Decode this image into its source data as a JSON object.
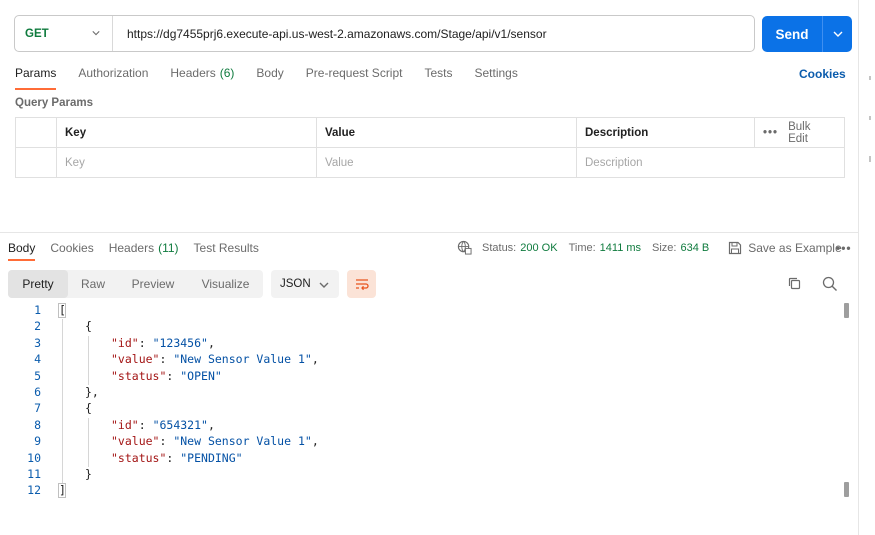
{
  "request": {
    "method": "GET",
    "url": "https://dg7455prj6.execute-api.us-west-2.amazonaws.com/Stage/api/v1/sensor",
    "send_label": "Send"
  },
  "request_tabs": [
    {
      "label": "Params",
      "count": "",
      "active": true
    },
    {
      "label": "Authorization",
      "count": "",
      "active": false
    },
    {
      "label": "Headers",
      "count": "(6)",
      "active": false
    },
    {
      "label": "Body",
      "count": "",
      "active": false
    },
    {
      "label": "Pre-request Script",
      "count": "",
      "active": false
    },
    {
      "label": "Tests",
      "count": "",
      "active": false
    },
    {
      "label": "Settings",
      "count": "",
      "active": false
    }
  ],
  "cookies_link": "Cookies",
  "query_params": {
    "title": "Query Params",
    "headers": {
      "key": "Key",
      "value": "Value",
      "description": "Description",
      "bulk_edit": "Bulk Edit"
    },
    "placeholders": {
      "key": "Key",
      "value": "Value",
      "description": "Description"
    }
  },
  "response_tabs": [
    {
      "label": "Body",
      "count": "",
      "active": true
    },
    {
      "label": "Cookies",
      "count": "",
      "active": false
    },
    {
      "label": "Headers",
      "count": "(11)",
      "active": false
    },
    {
      "label": "Test Results",
      "count": "",
      "active": false
    }
  ],
  "response_status": {
    "status_label": "Status:",
    "status_value": "200 OK",
    "time_label": "Time:",
    "time_value": "1411 ms",
    "size_label": "Size:",
    "size_value": "634 B",
    "save_label": "Save as Example"
  },
  "format_tabs": [
    {
      "label": "Pretty",
      "active": true
    },
    {
      "label": "Raw",
      "active": false
    },
    {
      "label": "Preview",
      "active": false
    },
    {
      "label": "Visualize",
      "active": false
    }
  ],
  "language": "JSON",
  "code_lines": [
    {
      "n": "1",
      "indent": 0,
      "parts": [
        [
          "p",
          "["
        ]
      ]
    },
    {
      "n": "2",
      "indent": 1,
      "parts": [
        [
          "p",
          "{"
        ]
      ]
    },
    {
      "n": "3",
      "indent": 2,
      "parts": [
        [
          "k",
          "\"id\""
        ],
        [
          "p",
          ": "
        ],
        [
          "s",
          "\"123456\""
        ],
        [
          "p",
          ","
        ]
      ]
    },
    {
      "n": "4",
      "indent": 2,
      "parts": [
        [
          "k",
          "\"value\""
        ],
        [
          "p",
          ": "
        ],
        [
          "s",
          "\"New Sensor Value 1\""
        ],
        [
          "p",
          ","
        ]
      ]
    },
    {
      "n": "5",
      "indent": 2,
      "parts": [
        [
          "k",
          "\"status\""
        ],
        [
          "p",
          ": "
        ],
        [
          "s",
          "\"OPEN\""
        ]
      ]
    },
    {
      "n": "6",
      "indent": 1,
      "parts": [
        [
          "p",
          "},"
        ]
      ]
    },
    {
      "n": "7",
      "indent": 1,
      "parts": [
        [
          "p",
          "{"
        ]
      ]
    },
    {
      "n": "8",
      "indent": 2,
      "parts": [
        [
          "k",
          "\"id\""
        ],
        [
          "p",
          ": "
        ],
        [
          "s",
          "\"654321\""
        ],
        [
          "p",
          ","
        ]
      ]
    },
    {
      "n": "9",
      "indent": 2,
      "parts": [
        [
          "k",
          "\"value\""
        ],
        [
          "p",
          ": "
        ],
        [
          "s",
          "\"New Sensor Value 1\""
        ],
        [
          "p",
          ","
        ]
      ]
    },
    {
      "n": "10",
      "indent": 2,
      "parts": [
        [
          "k",
          "\"status\""
        ],
        [
          "p",
          ": "
        ],
        [
          "s",
          "\"PENDING\""
        ]
      ]
    },
    {
      "n": "11",
      "indent": 1,
      "parts": [
        [
          "p",
          "}"
        ]
      ]
    },
    {
      "n": "12",
      "indent": 0,
      "parts": [
        [
          "p",
          "]"
        ]
      ]
    }
  ],
  "colors": {
    "accent_tab": "#ff6c37",
    "send_button": "#0b72e7",
    "method_get": "#0f7b3e",
    "status_ok": "#0f7b3e",
    "json_key": "#a31515",
    "json_string": "#0451a5"
  },
  "icons": [
    "chevron-down-icon",
    "globe-icon",
    "save-icon",
    "more-icon",
    "wrap-lines-icon",
    "copy-icon",
    "search-icon"
  ]
}
